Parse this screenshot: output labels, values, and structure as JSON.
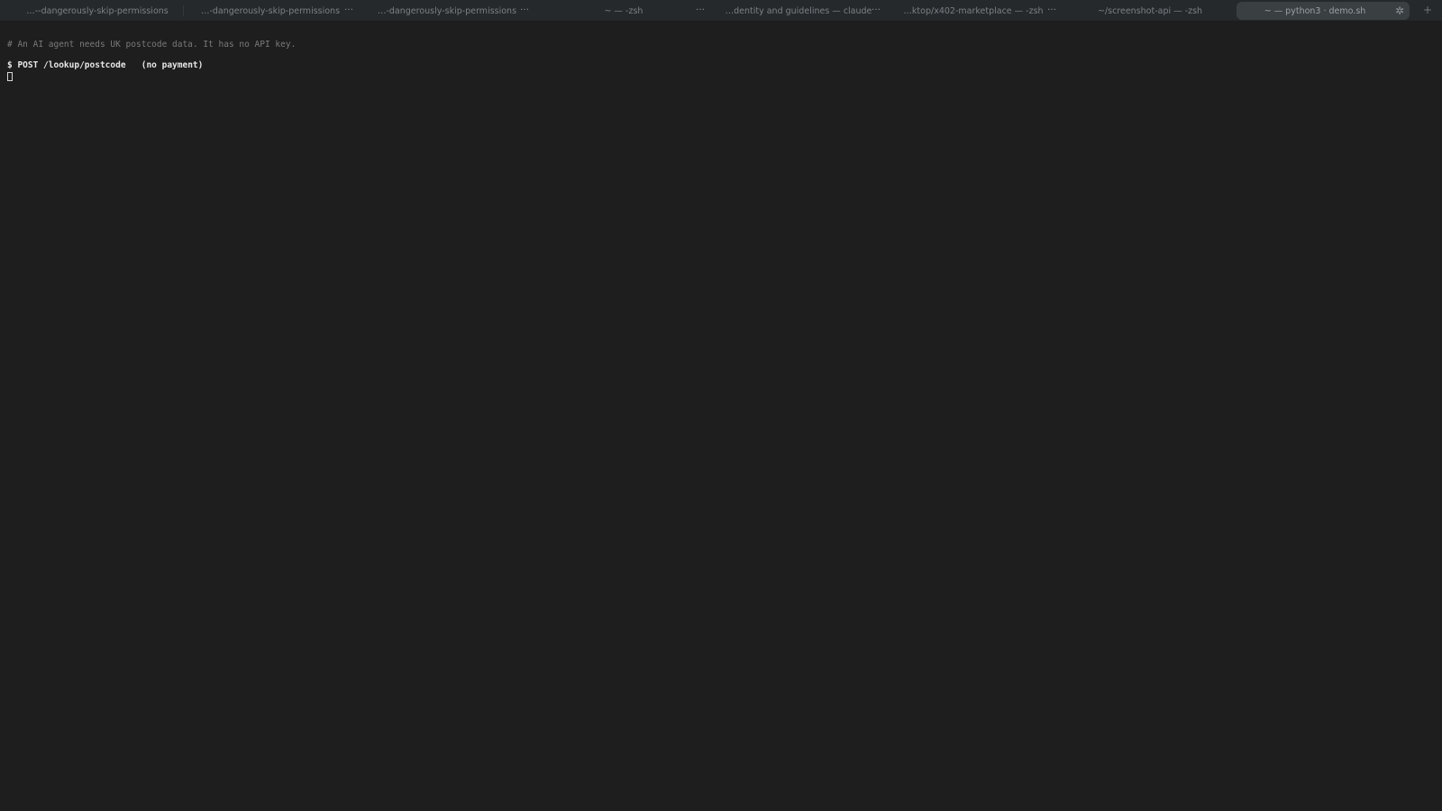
{
  "tabs": [
    {
      "label": "…--dangerously-skip-permissions",
      "active": false,
      "has_menu": false
    },
    {
      "label": "…-dangerously-skip-permissions",
      "active": false,
      "has_menu": true
    },
    {
      "label": "…-dangerously-skip-permissions",
      "active": false,
      "has_menu": true
    },
    {
      "label": "~ — -zsh",
      "active": false,
      "has_menu": true
    },
    {
      "label": "…dentity and guidelines — claude",
      "active": false,
      "has_menu": true
    },
    {
      "label": "…ktop/x402-marketplace — -zsh",
      "active": false,
      "has_menu": true
    },
    {
      "label": "~/screenshot-api — -zsh",
      "active": false,
      "has_menu": false
    },
    {
      "label": "~ — python3 · demo.sh",
      "active": true,
      "has_menu": false
    }
  ],
  "tab_menu_glyph": "…",
  "new_tab_glyph": "+",
  "activity_icon": "spinner-icon",
  "terminal": {
    "comment_line": "# An AI agent needs UK postcode data. It has no API key.",
    "command_prompt": "$ POST /lookup/postcode",
    "command_note": "(no payment)"
  },
  "colors": {
    "background": "#1e1e1e",
    "tabbar": "#25292b",
    "active_tab": "#3a3f42",
    "comment": "#7a7a7a",
    "command": "#e6e6e6"
  }
}
